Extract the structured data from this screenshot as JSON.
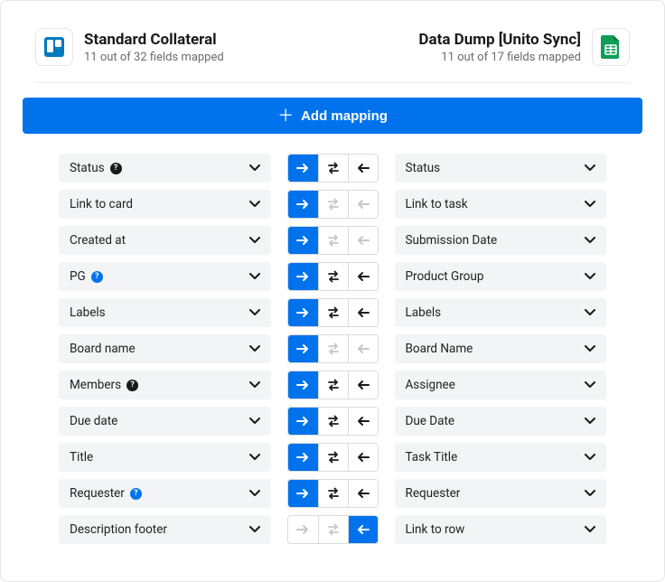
{
  "header": {
    "left": {
      "title": "Standard Collateral",
      "subtitle": "11 out of 32 fields mapped",
      "tool": "trello"
    },
    "right": {
      "title": "Data Dump [Unito Sync]",
      "subtitle": "11 out of 17 fields mapped",
      "tool": "google-sheets"
    }
  },
  "addButton": {
    "label": "Add mapping"
  },
  "colors": {
    "accent": "#0073ec",
    "trello": "#0079BF",
    "sheets": "#0F9D58"
  },
  "rows": [
    {
      "left": "Status",
      "leftBadge": "dark",
      "right": "Status",
      "dir": "right",
      "bothEnabled": true,
      "leftBtnEnabled": true
    },
    {
      "left": "Link to card",
      "leftBadge": null,
      "right": "Link to task",
      "dir": "right",
      "bothEnabled": false,
      "leftBtnEnabled": false
    },
    {
      "left": "Created at",
      "leftBadge": null,
      "right": "Submission Date",
      "dir": "right",
      "bothEnabled": false,
      "leftBtnEnabled": false
    },
    {
      "left": "PG",
      "leftBadge": "blue",
      "right": "Product Group",
      "dir": "right",
      "bothEnabled": true,
      "leftBtnEnabled": true
    },
    {
      "left": "Labels",
      "leftBadge": null,
      "right": "Labels",
      "dir": "right",
      "bothEnabled": true,
      "leftBtnEnabled": true
    },
    {
      "left": "Board name",
      "leftBadge": null,
      "right": "Board Name",
      "dir": "right",
      "bothEnabled": false,
      "leftBtnEnabled": false
    },
    {
      "left": "Members",
      "leftBadge": "dark",
      "right": "Assignee",
      "dir": "right",
      "bothEnabled": true,
      "leftBtnEnabled": true
    },
    {
      "left": "Due date",
      "leftBadge": null,
      "right": "Due Date",
      "dir": "right",
      "bothEnabled": true,
      "leftBtnEnabled": true
    },
    {
      "left": "Title",
      "leftBadge": null,
      "right": "Task Title",
      "dir": "right",
      "bothEnabled": true,
      "leftBtnEnabled": true
    },
    {
      "left": "Requester",
      "leftBadge": "blue",
      "right": "Requester",
      "dir": "right",
      "bothEnabled": true,
      "leftBtnEnabled": true
    },
    {
      "left": "Description footer",
      "leftBadge": null,
      "right": "Link to row",
      "dir": "left",
      "bothEnabled": false,
      "leftBtnEnabled": true
    }
  ]
}
